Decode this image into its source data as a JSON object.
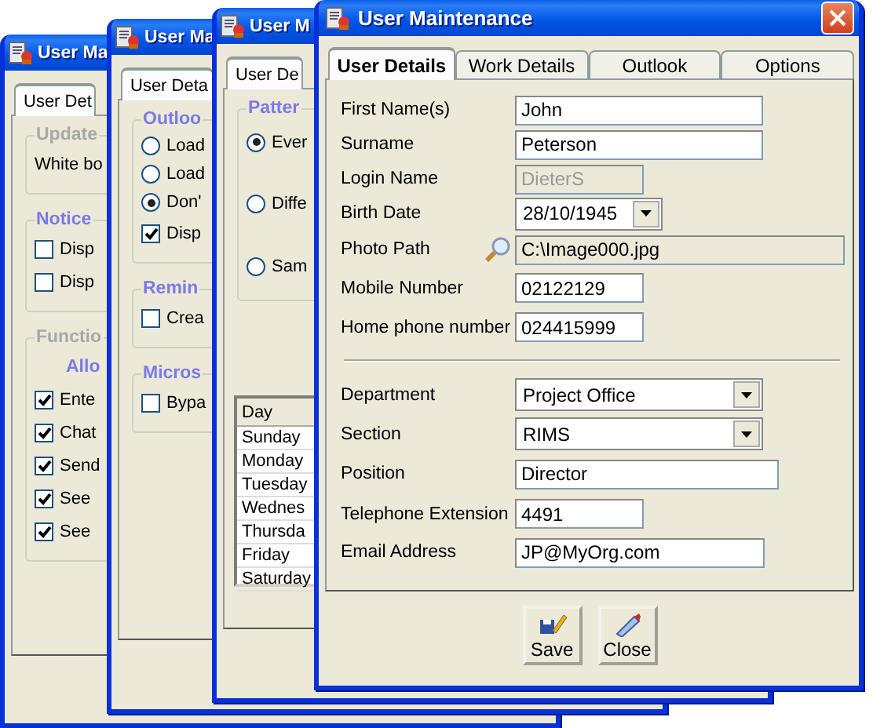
{
  "back_windows": [
    {
      "title": "User Ma",
      "tab": "User Det",
      "groups": [
        {
          "title": "Update",
          "disabled": true,
          "items": [
            {
              "kind": "text",
              "label": "White bo"
            }
          ]
        },
        {
          "title": "Notice",
          "disabled": false,
          "items": [
            {
              "kind": "checkbox",
              "label": "Disp",
              "checked": false
            },
            {
              "kind": "checkbox",
              "label": "Disp",
              "checked": false
            }
          ]
        },
        {
          "title": "Functio",
          "disabled": true,
          "items": [
            {
              "kind": "subheading",
              "label": "Allo"
            },
            {
              "kind": "checkbox",
              "label": "Ente",
              "checked": true
            },
            {
              "kind": "checkbox",
              "label": "Chat",
              "checked": true
            },
            {
              "kind": "checkbox",
              "label": "Send",
              "checked": true
            },
            {
              "kind": "checkbox",
              "label": "See",
              "checked": true
            },
            {
              "kind": "checkbox",
              "label": "See",
              "checked": true
            }
          ]
        }
      ]
    },
    {
      "title": "User Ma",
      "tab": "User Deta",
      "groups": [
        {
          "title": "Outloo",
          "disabled": false,
          "items": [
            {
              "kind": "radio",
              "label": "Load",
              "selected": false
            },
            {
              "kind": "radio",
              "label": "Load",
              "selected": false
            },
            {
              "kind": "radio",
              "label": "Don'",
              "selected": true
            },
            {
              "kind": "checkbox",
              "label": "Disp",
              "checked": true
            }
          ]
        },
        {
          "title": "Remin",
          "disabled": false,
          "items": [
            {
              "kind": "checkbox",
              "label": "Crea",
              "checked": false
            }
          ]
        },
        {
          "title": "Micros",
          "disabled": false,
          "items": [
            {
              "kind": "checkbox",
              "label": "Bypa",
              "checked": false
            }
          ]
        }
      ]
    },
    {
      "title": "User M",
      "tab": "User De",
      "groups": [
        {
          "title": "Patter",
          "disabled": false,
          "items": [
            {
              "kind": "radio",
              "label": "Ever",
              "selected": true
            },
            {
              "kind": "radio",
              "label": "Diffe",
              "selected": false
            },
            {
              "kind": "radio",
              "label": "Sam",
              "selected": false
            }
          ]
        }
      ],
      "list": {
        "header": "Day",
        "rows": [
          "Sunday",
          "Monday",
          "Tuesday",
          "Wednes",
          "Thursda",
          "Friday",
          "Saturday"
        ]
      }
    }
  ],
  "window": {
    "title": "User Maintenance",
    "tabs": [
      {
        "label": "User Details",
        "selected": true
      },
      {
        "label": "Work Details",
        "selected": false
      },
      {
        "label": "Outlook",
        "selected": false
      },
      {
        "label": "Options",
        "selected": false
      }
    ],
    "sections": [
      [
        {
          "label": "First Name(s)",
          "kind": "text",
          "value": "John",
          "disabled": false
        },
        {
          "label": "Surname",
          "kind": "text",
          "value": "Peterson",
          "disabled": false
        },
        {
          "label": "Login Name",
          "kind": "text",
          "value": "DieterS",
          "disabled": true
        },
        {
          "label": "Birth Date",
          "kind": "date",
          "value": "28/10/1945",
          "disabled": false
        },
        {
          "label": "Photo Path",
          "kind": "photo",
          "value": "C:\\Image000.jpg",
          "disabled": false
        },
        {
          "label": "Mobile Number",
          "kind": "text",
          "value": "02122129",
          "disabled": false
        },
        {
          "label": "Home phone number",
          "kind": "text",
          "value": "024415999",
          "disabled": false
        }
      ],
      [
        {
          "label": "Department",
          "kind": "combo",
          "value": "Project Office",
          "disabled": false
        },
        {
          "label": "Section",
          "kind": "combo",
          "value": "RIMS",
          "disabled": false
        },
        {
          "label": "Position",
          "kind": "text",
          "value": "Director",
          "disabled": false
        },
        {
          "label": "Telephone Extension",
          "kind": "text",
          "value": "4491",
          "disabled": false
        },
        {
          "label": "Email Address",
          "kind": "text",
          "value": "JP@MyOrg.com",
          "disabled": false
        }
      ]
    ],
    "buttons": [
      {
        "kind": "save",
        "label": "Save"
      },
      {
        "kind": "close",
        "label": "Close"
      }
    ]
  }
}
